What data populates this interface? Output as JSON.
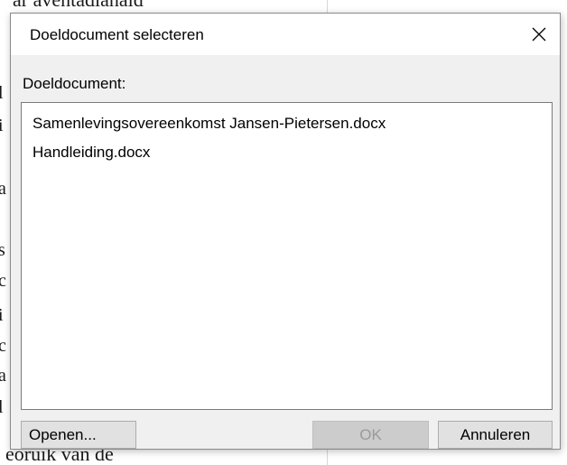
{
  "background": {
    "top_fragment": "ar aventadianaid",
    "bottom_fragment": "eoruik van de",
    "edge_letters": [
      "l",
      "i",
      "a",
      "s",
      "c",
      "i",
      "c",
      "a",
      "l"
    ]
  },
  "dialog": {
    "title": "Doeldocument selecteren",
    "close_glyph": "✕",
    "field_label": "Doeldocument:",
    "list_items": [
      "Samenlevingsovereenkomst Jansen-Pietersen.docx",
      "Handleiding.docx"
    ],
    "buttons": {
      "open": "Openen...",
      "ok": "OK",
      "cancel": "Annuleren"
    }
  },
  "colors": {
    "dialog_bg": "#f0f0f0",
    "titlebar_bg": "#ffffff",
    "button_bg": "#e1e1e1",
    "disabled_text": "#9a9a9a"
  }
}
